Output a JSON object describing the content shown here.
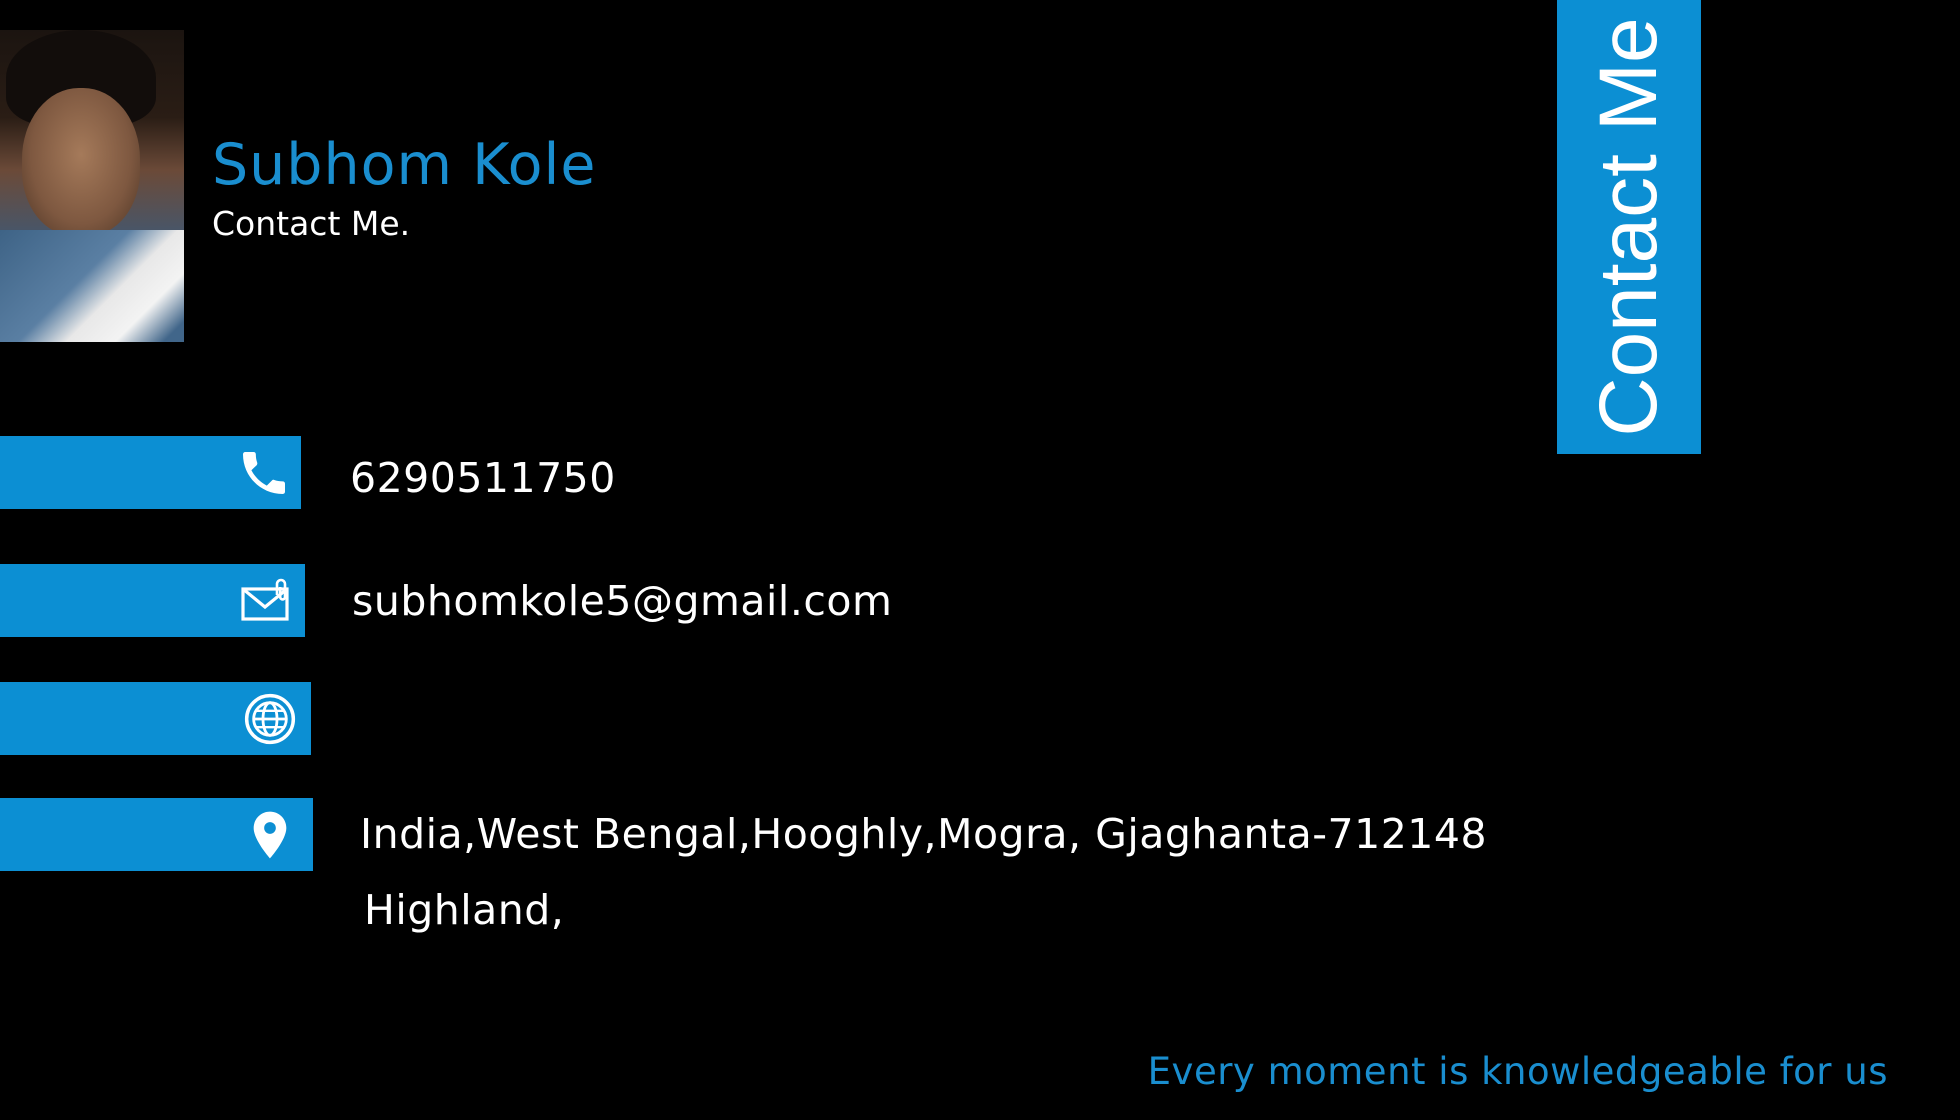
{
  "header": {
    "name": "Subhom Kole",
    "subtitle": "Contact Me."
  },
  "banner": {
    "text": "Contact Me"
  },
  "contacts": {
    "phone": {
      "icon": "phone-icon",
      "value": "6290511750"
    },
    "email": {
      "icon": "mail-icon",
      "value": "subhomkole5@gmail.com"
    },
    "website": {
      "icon": "globe-icon",
      "value": ""
    },
    "address": {
      "icon": "location-pin-icon",
      "line1": "India,West Bengal,Hooghly,Mogra, Gjaghanta-712148",
      "line2": "Highland,"
    }
  },
  "footer": {
    "tagline": "Every moment is knowledgeable for us"
  },
  "colors": {
    "accent": "#0c8fd3",
    "accent_text": "#1a8ecf",
    "background": "#000000",
    "text": "#ffffff"
  }
}
